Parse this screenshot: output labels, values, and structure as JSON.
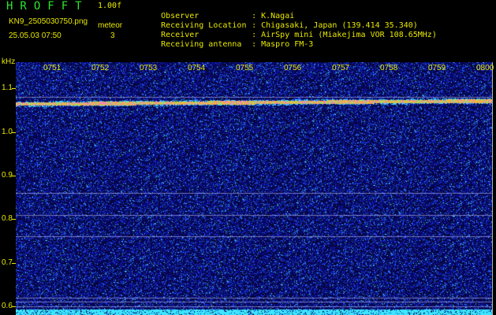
{
  "header": {
    "app_title": "HROFFT",
    "version": "1.00f",
    "filename": "KN9_2505030750.png",
    "mode_label": "meteor",
    "datetime": "25.05.03 07:50",
    "mode_value": "3",
    "info": [
      {
        "label": "Observer",
        "value": "K.Nagai"
      },
      {
        "label": "Receiving Location",
        "value": "Chigasaki, Japan (139.414 35.340)"
      },
      {
        "label": "Receiver",
        "value": "AirSpy mini (Miakejima VOR 108.65MHz)"
      },
      {
        "label": "Receiving antenna",
        "value": "Maspro FM-3"
      }
    ],
    "separator": ":"
  },
  "chart_data": {
    "type": "heatmap",
    "title": "",
    "xlabel": "",
    "ylabel": "kHz",
    "x_ticks": [
      "0751",
      "0752",
      "0753",
      "0754",
      "0755",
      "0756",
      "0757",
      "0758",
      "0759",
      "0800"
    ],
    "y_ticks": [
      "1.1",
      "1.0",
      "0.9",
      "0.8",
      "0.7",
      "0.6"
    ],
    "ylim": [
      0.58,
      1.16
    ],
    "carrier_khz": 1.07,
    "interference_lines_khz": [
      1.08,
      0.86,
      0.81,
      0.76,
      0.62,
      0.61,
      0.6
    ],
    "colors": {
      "background": "#06063a",
      "noise_low": "#0a0aa0",
      "noise_mid": "#2050ff",
      "noise_high": "#40e0ff",
      "carrier": "#ffb000",
      "label": "#e8e800",
      "title": "#2ee52e"
    }
  }
}
